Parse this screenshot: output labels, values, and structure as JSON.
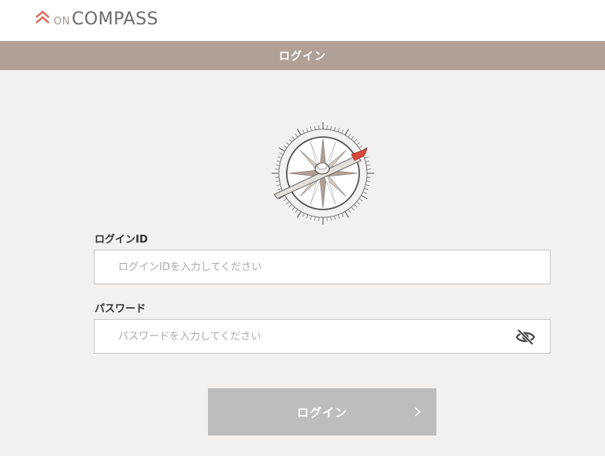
{
  "header": {
    "logo_prefix": "ON",
    "logo_name": "COMPASS"
  },
  "titlebar": {
    "title": "ログイン"
  },
  "form": {
    "login_id_label": "ログインID",
    "login_id_placeholder": "ログインIDを入力してください",
    "login_id_value": "",
    "password_label": "パスワード",
    "password_placeholder": "パスワードを入力してください",
    "password_value": ""
  },
  "submit": {
    "label": "ログイン"
  },
  "icons": {
    "logo": "chevron-up-double-icon",
    "compass": "compass-icon",
    "password_toggle": "eye-off-icon",
    "submit": "chevron-right-icon"
  },
  "colors": {
    "background": "#f3f1ef",
    "title_bar": "#b0a096",
    "button_disabled": "#bdbdbd",
    "logo_accent": "#d8675a",
    "logo_text": "#6b6b6b"
  }
}
